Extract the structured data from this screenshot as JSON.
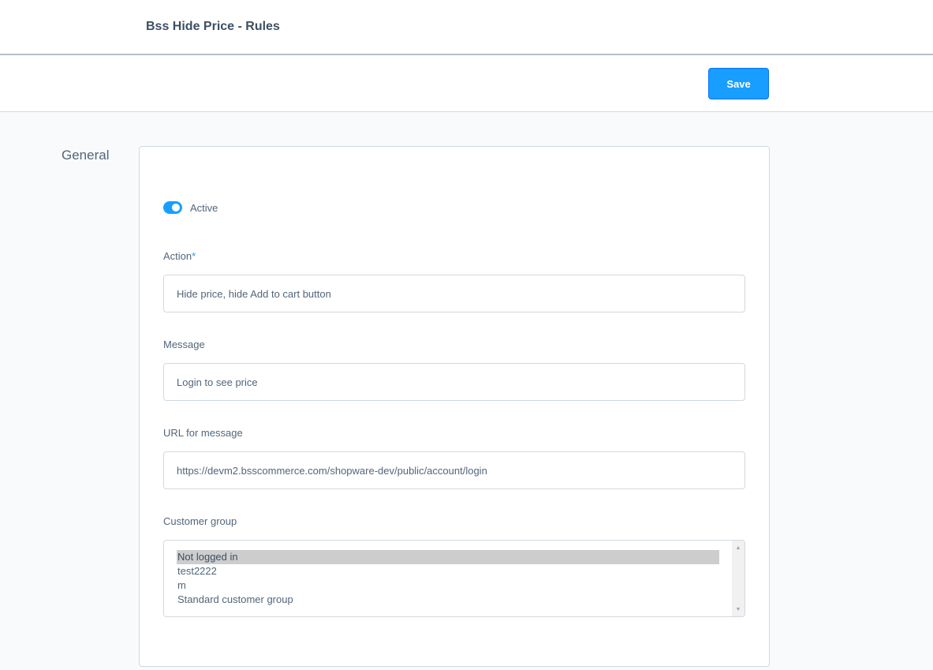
{
  "header": {
    "title": "Bss Hide Price - Rules"
  },
  "toolbar": {
    "save_label": "Save"
  },
  "section": {
    "label": "General"
  },
  "form": {
    "active": {
      "label": "Active",
      "checked": true
    },
    "action": {
      "label": "Action",
      "required_mark": "*",
      "value": "Hide price, hide Add to cart button"
    },
    "message": {
      "label": "Message",
      "value": "Login to see price"
    },
    "url": {
      "label": "URL for message",
      "value": "https://devm2.bsscommerce.com/shopware-dev/public/account/login"
    },
    "customer_group": {
      "label": "Customer group",
      "options": [
        "Not logged in",
        "test2222",
        "m",
        "Standard customer group"
      ],
      "selected": "Not logged in"
    }
  },
  "icons": {
    "scroll_up": "scroll-up-arrow-icon",
    "scroll_down": "scroll-down-arrow-icon"
  },
  "colors": {
    "accent": "#189eff",
    "title": "#3d4f63",
    "text": "#52667a",
    "border": "#d1d9e0"
  }
}
